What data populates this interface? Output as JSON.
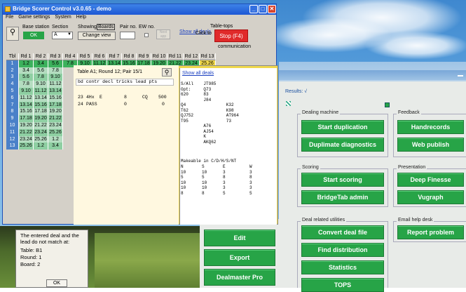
{
  "window": {
    "title": "Bridge Scorer Control v3.0.65 - demo",
    "menu": [
      "File",
      "Game settings",
      "System",
      "Help"
    ]
  },
  "toolbar": {
    "base_station_label": "Base station",
    "section_label": "Section",
    "ok_label": "OK",
    "section_value": "A",
    "showing_label": "Showing",
    "boards_label": "Boards",
    "change_view_label": "Change view",
    "pair_no_label": "Pair no.",
    "ew_no_label": "EW no.",
    "next_label": "Next app",
    "show_all_deals_label": "Show all deals",
    "tabletops_label": "Table-tops",
    "click_to_label": "Click to",
    "stop_label": "Stop (F4)",
    "communication_label": "communication"
  },
  "results_table": {
    "headers": [
      "Tbl",
      "Rd 1",
      "Rd 2",
      "Rd 3",
      "Rd 4",
      "Rd 5",
      "Rd 6",
      "Rd 7",
      "Rd 8",
      "Rd 9",
      "Rd 10",
      "Rd 11",
      "Rd 12",
      "Rd 13"
    ],
    "rows": [
      [
        "1",
        "1.2",
        "3.4",
        "5.6",
        "7.8",
        "9.10",
        "11.12",
        "13.14",
        "15.16",
        "17.18",
        "19.20",
        "21.22",
        "23.24",
        "25.26"
      ],
      [
        "2",
        "3.4",
        "5.6",
        "7.8"
      ],
      [
        "3",
        "5.6",
        "7.8",
        "9.10"
      ],
      [
        "4",
        "7.8",
        "9.10",
        "11.12"
      ],
      [
        "5",
        "9.10",
        "11.12",
        "13.14"
      ],
      [
        "6",
        "11.12",
        "13.14",
        "15.16"
      ],
      [
        "7",
        "13.14",
        "15.16",
        "17.18"
      ],
      [
        "8",
        "15.16",
        "17.18",
        "19.20"
      ],
      [
        "9",
        "17.18",
        "19.20",
        "21.22"
      ],
      [
        "10",
        "19.20",
        "21.22",
        "23.24"
      ],
      [
        "11",
        "21.22",
        "23.24",
        "25.26"
      ],
      [
        "12",
        "23.24",
        "25.26",
        "1.2"
      ],
      [
        "13",
        "25.26",
        "1.2",
        "3.4"
      ]
    ]
  },
  "popup": {
    "title": "Table A1; Round 12; Pair 15/1",
    "header_row": "bd contr decl tricks lead pts",
    "row1": {
      "bd": "23",
      "contract": "4Hx",
      "decl": "E",
      "tricks": "8",
      "lead": "CQ",
      "pts": "500"
    },
    "row2": {
      "bd": "24",
      "contract": "PASS",
      "tricks": "0",
      "pts": "0"
    },
    "show_all_deals": "Show all deals",
    "hand_lines": [
      "S/All    JT985",
      "Opt:     Q73",
      "620      83",
      "         J84",
      "Q4                K32",
      "T62               K98",
      "QJ752             AT964",
      "T95               73",
      "         A76",
      "         AJ54",
      "         K",
      "         AKQ62"
    ],
    "makeable_title": "Makeable in C/D/H/S/NT",
    "makeable_header": [
      "N",
      "S",
      "E",
      "W"
    ],
    "makeable_rows": [
      [
        "10",
        "10",
        "3",
        "3"
      ],
      [
        "5",
        "5",
        "8",
        "8"
      ],
      [
        "10",
        "10",
        "3",
        "3"
      ],
      [
        "10",
        "10",
        "3",
        "3"
      ],
      [
        "8",
        "8",
        "5",
        "5"
      ]
    ]
  },
  "dialog": {
    "message": "The entered deal and the lead do not match at:",
    "table": "Table: B1",
    "round": "Round: 1",
    "board": "Board: 2",
    "ok_label": "OK"
  },
  "middle_buttons": [
    "Edit",
    "Export",
    "Dealmaster Pro"
  ],
  "main_app": {
    "results_label": "Results: √",
    "groups": {
      "dealing_machine": {
        "title": "Dealing machine",
        "buttons": [
          "Start duplication",
          "Duplimate diagnostics"
        ]
      },
      "feedback": {
        "title": "Feedback",
        "buttons": [
          "Handrecords",
          "Web publish"
        ]
      },
      "scoring": {
        "title": "Scoring",
        "buttons": [
          "Start scoring",
          "BridgeTab admin"
        ]
      },
      "presentation": {
        "title": "Presentation",
        "buttons": [
          "Deep Finesse",
          "Vugraph"
        ]
      },
      "deal_utilities": {
        "title": "Deal related utilities",
        "buttons": [
          "Convert deal file",
          "Find distribution",
          "Statistics",
          "TOPS"
        ]
      },
      "email_help": {
        "title": "Email help desk",
        "buttons": [
          "Report problem"
        ]
      }
    }
  },
  "colors": {
    "accent_green": "#27a447",
    "stop_red": "#e02a2a",
    "popup_yellow": "#f0d84c",
    "title_blue": "#1d56d4"
  }
}
